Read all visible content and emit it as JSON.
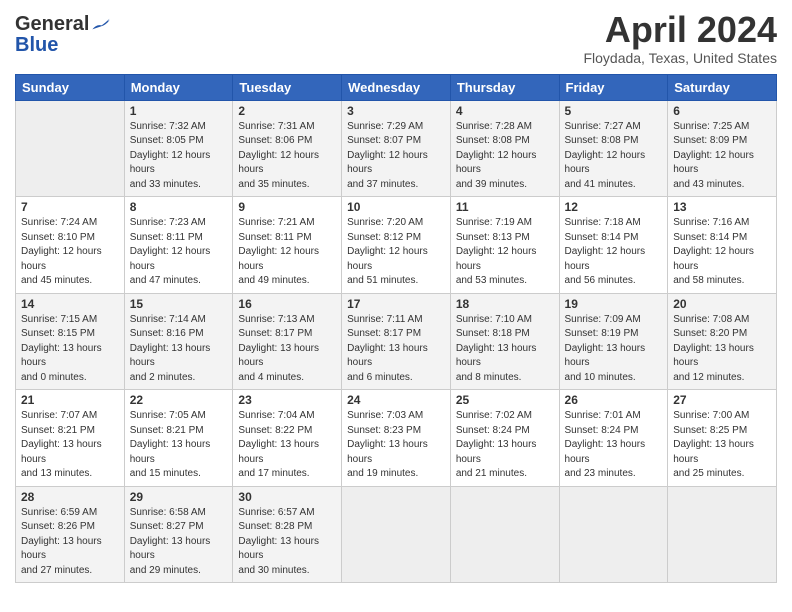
{
  "header": {
    "logo_general": "General",
    "logo_blue": "Blue",
    "month_title": "April 2024",
    "location": "Floydada, Texas, United States"
  },
  "weekdays": [
    "Sunday",
    "Monday",
    "Tuesday",
    "Wednesday",
    "Thursday",
    "Friday",
    "Saturday"
  ],
  "weeks": [
    [
      {
        "day": "",
        "empty": true
      },
      {
        "day": "1",
        "sunrise": "7:32 AM",
        "sunset": "8:05 PM",
        "daylight": "12 hours and 33 minutes."
      },
      {
        "day": "2",
        "sunrise": "7:31 AM",
        "sunset": "8:06 PM",
        "daylight": "12 hours and 35 minutes."
      },
      {
        "day": "3",
        "sunrise": "7:29 AM",
        "sunset": "8:07 PM",
        "daylight": "12 hours and 37 minutes."
      },
      {
        "day": "4",
        "sunrise": "7:28 AM",
        "sunset": "8:08 PM",
        "daylight": "12 hours and 39 minutes."
      },
      {
        "day": "5",
        "sunrise": "7:27 AM",
        "sunset": "8:08 PM",
        "daylight": "12 hours and 41 minutes."
      },
      {
        "day": "6",
        "sunrise": "7:25 AM",
        "sunset": "8:09 PM",
        "daylight": "12 hours and 43 minutes."
      }
    ],
    [
      {
        "day": "7",
        "sunrise": "7:24 AM",
        "sunset": "8:10 PM",
        "daylight": "12 hours and 45 minutes."
      },
      {
        "day": "8",
        "sunrise": "7:23 AM",
        "sunset": "8:11 PM",
        "daylight": "12 hours and 47 minutes."
      },
      {
        "day": "9",
        "sunrise": "7:21 AM",
        "sunset": "8:11 PM",
        "daylight": "12 hours and 49 minutes."
      },
      {
        "day": "10",
        "sunrise": "7:20 AM",
        "sunset": "8:12 PM",
        "daylight": "12 hours and 51 minutes."
      },
      {
        "day": "11",
        "sunrise": "7:19 AM",
        "sunset": "8:13 PM",
        "daylight": "12 hours and 53 minutes."
      },
      {
        "day": "12",
        "sunrise": "7:18 AM",
        "sunset": "8:14 PM",
        "daylight": "12 hours and 56 minutes."
      },
      {
        "day": "13",
        "sunrise": "7:16 AM",
        "sunset": "8:14 PM",
        "daylight": "12 hours and 58 minutes."
      }
    ],
    [
      {
        "day": "14",
        "sunrise": "7:15 AM",
        "sunset": "8:15 PM",
        "daylight": "13 hours and 0 minutes."
      },
      {
        "day": "15",
        "sunrise": "7:14 AM",
        "sunset": "8:16 PM",
        "daylight": "13 hours and 2 minutes."
      },
      {
        "day": "16",
        "sunrise": "7:13 AM",
        "sunset": "8:17 PM",
        "daylight": "13 hours and 4 minutes."
      },
      {
        "day": "17",
        "sunrise": "7:11 AM",
        "sunset": "8:17 PM",
        "daylight": "13 hours and 6 minutes."
      },
      {
        "day": "18",
        "sunrise": "7:10 AM",
        "sunset": "8:18 PM",
        "daylight": "13 hours and 8 minutes."
      },
      {
        "day": "19",
        "sunrise": "7:09 AM",
        "sunset": "8:19 PM",
        "daylight": "13 hours and 10 minutes."
      },
      {
        "day": "20",
        "sunrise": "7:08 AM",
        "sunset": "8:20 PM",
        "daylight": "13 hours and 12 minutes."
      }
    ],
    [
      {
        "day": "21",
        "sunrise": "7:07 AM",
        "sunset": "8:21 PM",
        "daylight": "13 hours and 13 minutes."
      },
      {
        "day": "22",
        "sunrise": "7:05 AM",
        "sunset": "8:21 PM",
        "daylight": "13 hours and 15 minutes."
      },
      {
        "day": "23",
        "sunrise": "7:04 AM",
        "sunset": "8:22 PM",
        "daylight": "13 hours and 17 minutes."
      },
      {
        "day": "24",
        "sunrise": "7:03 AM",
        "sunset": "8:23 PM",
        "daylight": "13 hours and 19 minutes."
      },
      {
        "day": "25",
        "sunrise": "7:02 AM",
        "sunset": "8:24 PM",
        "daylight": "13 hours and 21 minutes."
      },
      {
        "day": "26",
        "sunrise": "7:01 AM",
        "sunset": "8:24 PM",
        "daylight": "13 hours and 23 minutes."
      },
      {
        "day": "27",
        "sunrise": "7:00 AM",
        "sunset": "8:25 PM",
        "daylight": "13 hours and 25 minutes."
      }
    ],
    [
      {
        "day": "28",
        "sunrise": "6:59 AM",
        "sunset": "8:26 PM",
        "daylight": "13 hours and 27 minutes."
      },
      {
        "day": "29",
        "sunrise": "6:58 AM",
        "sunset": "8:27 PM",
        "daylight": "13 hours and 29 minutes."
      },
      {
        "day": "30",
        "sunrise": "6:57 AM",
        "sunset": "8:28 PM",
        "daylight": "13 hours and 30 minutes."
      },
      {
        "day": "",
        "empty": true
      },
      {
        "day": "",
        "empty": true
      },
      {
        "day": "",
        "empty": true
      },
      {
        "day": "",
        "empty": true
      }
    ]
  ],
  "labels": {
    "sunrise": "Sunrise:",
    "sunset": "Sunset:",
    "daylight": "Daylight:"
  }
}
